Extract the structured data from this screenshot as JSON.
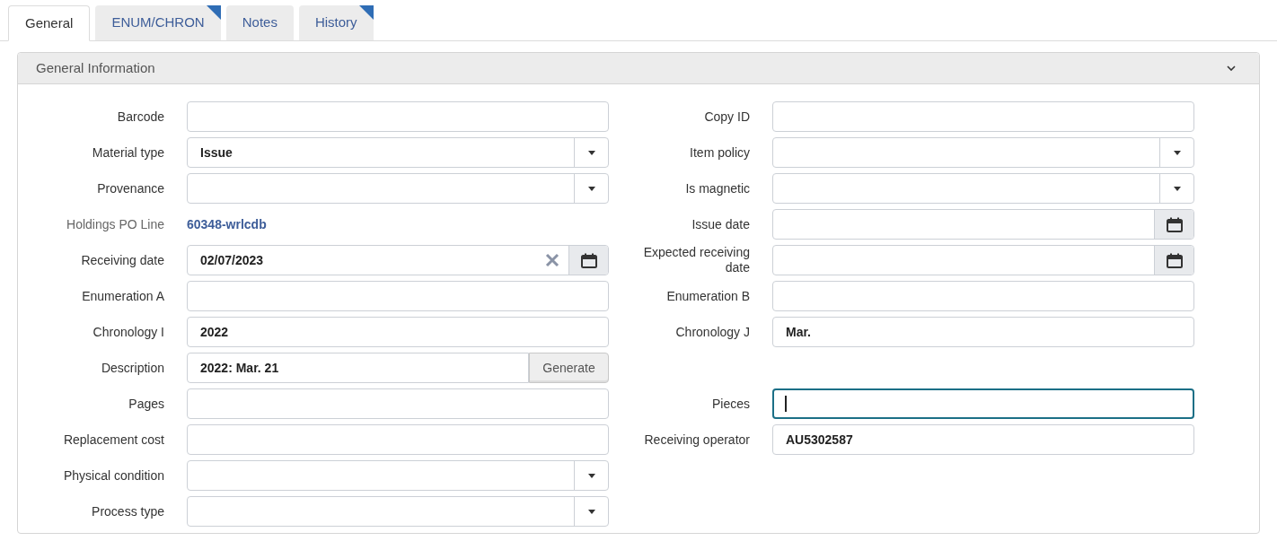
{
  "tabs": [
    {
      "label": "General",
      "selected": true,
      "flagged": false
    },
    {
      "label": "ENUM/CHRON",
      "selected": false,
      "flagged": true
    },
    {
      "label": "Notes",
      "selected": false,
      "flagged": false
    },
    {
      "label": "History",
      "selected": false,
      "flagged": true
    }
  ],
  "section": {
    "title": "General Information",
    "expanded": true
  },
  "rows": [
    {
      "left": {
        "label": "Barcode",
        "kind": "text"
      },
      "right": {
        "label": "Copy ID",
        "kind": "text"
      }
    },
    {
      "left": {
        "label": "Material type",
        "kind": "select",
        "value": "Issue"
      },
      "right": {
        "label": "Item policy",
        "kind": "select"
      }
    },
    {
      "left": {
        "label": "Provenance",
        "kind": "select"
      },
      "right": {
        "label": "Is magnetic",
        "kind": "select"
      }
    },
    {
      "left": {
        "label": "Holdings PO Line",
        "kind": "link",
        "value": "60348-wrlcdb"
      },
      "right": {
        "label": "Issue date",
        "kind": "date",
        "clearable": false
      }
    },
    {
      "left": {
        "label": "Receiving date",
        "kind": "date",
        "value": "02/07/2023",
        "clearable": true
      },
      "right": {
        "label": "Expected receiving date",
        "kind": "date",
        "clearable": false
      }
    },
    {
      "left": {
        "label": "Enumeration A",
        "kind": "text"
      },
      "right": {
        "label": "Enumeration B",
        "kind": "text"
      }
    },
    {
      "left": {
        "label": "Chronology I",
        "kind": "text",
        "value": "2022"
      },
      "right": {
        "label": "Chronology J",
        "kind": "text",
        "value": "Mar."
      }
    },
    {
      "left": {
        "label": "Description",
        "kind": "generate",
        "value": "2022: Mar. 21",
        "button": "Generate"
      }
    },
    {
      "left": {
        "label": "Pages",
        "kind": "text"
      },
      "right": {
        "label": "Pieces",
        "kind": "text",
        "focused": true
      }
    },
    {
      "left": {
        "label": "Replacement cost",
        "kind": "text"
      },
      "right": {
        "label": "Receiving operator",
        "kind": "text",
        "value": "AU5302587"
      }
    },
    {
      "left": {
        "label": "Physical condition",
        "kind": "select"
      }
    },
    {
      "left": {
        "label": "Process type",
        "kind": "select"
      }
    }
  ]
}
